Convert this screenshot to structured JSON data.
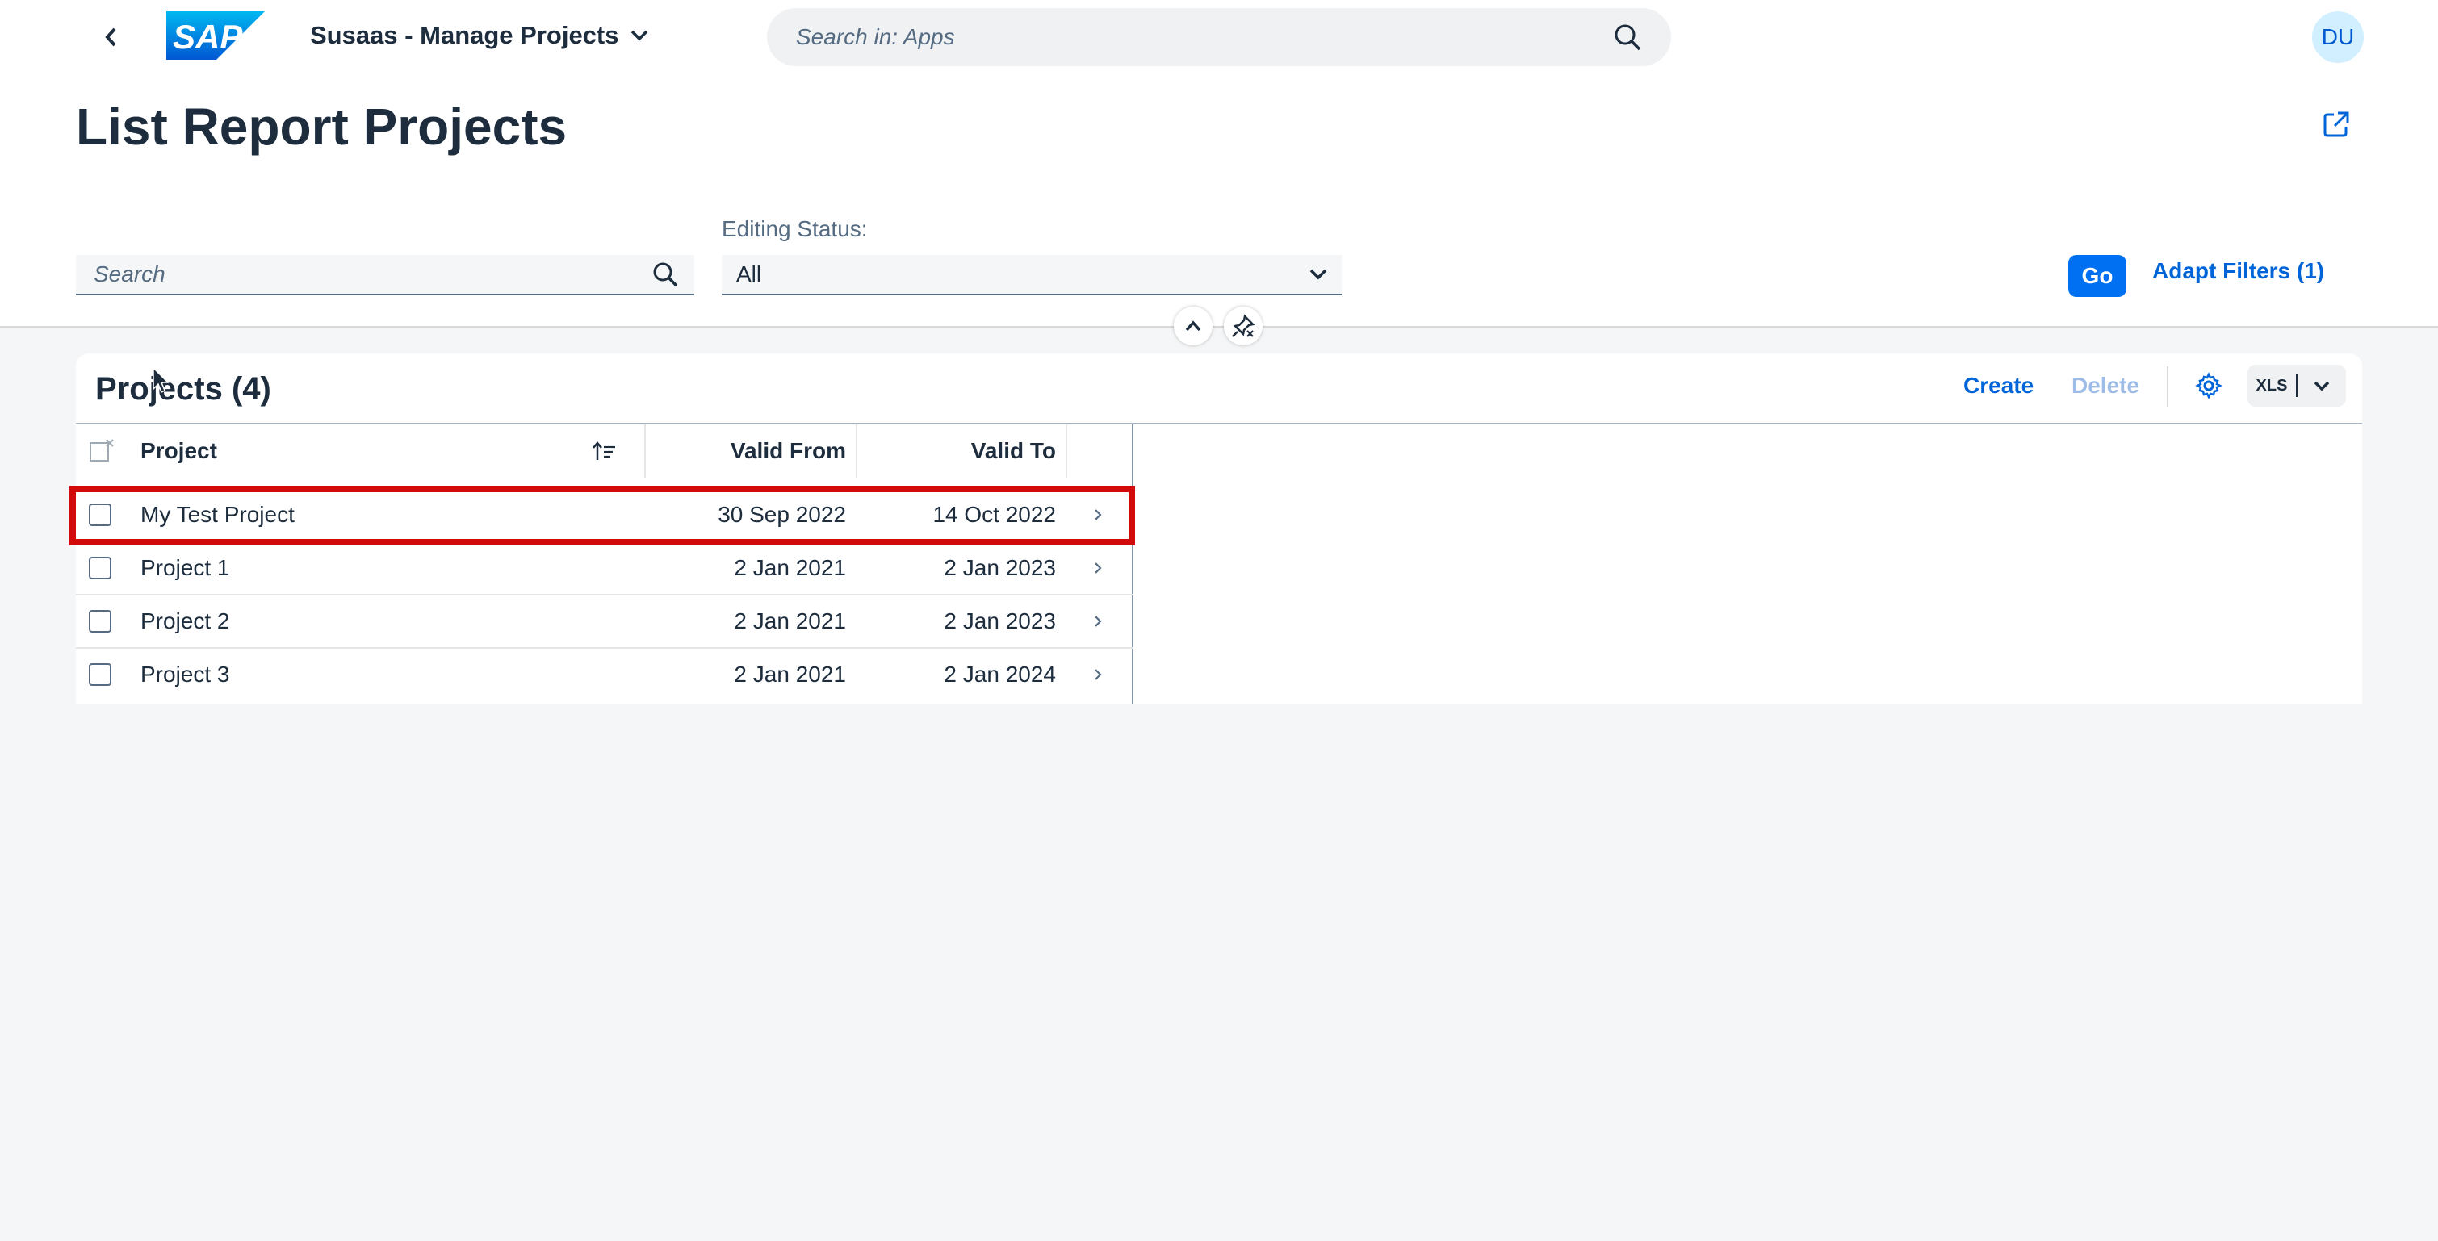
{
  "shell": {
    "logo_text": "SAP",
    "app_title": "Susaas - Manage Projects",
    "search_placeholder": "Search in: Apps",
    "user_initials": "DU"
  },
  "page": {
    "title": "List Report Projects"
  },
  "filter_bar": {
    "search_placeholder": "Search",
    "editing_status_label": "Editing Status:",
    "editing_status_value": "All",
    "go_label": "Go",
    "adapt_filters_label": "Adapt Filters (1)"
  },
  "table": {
    "title": "Projects (4)",
    "create_label": "Create",
    "delete_label": "Delete",
    "export_label": "XLS",
    "columns": [
      "Project",
      "Valid From",
      "Valid To"
    ],
    "rows": [
      {
        "project": "My Test Project",
        "valid_from": "30 Sep 2022",
        "valid_to": "14 Oct 2022"
      },
      {
        "project": "Project 1",
        "valid_from": "2 Jan 2021",
        "valid_to": "2 Jan 2023"
      },
      {
        "project": "Project 2",
        "valid_from": "2 Jan 2021",
        "valid_to": "2 Jan 2023"
      },
      {
        "project": "Project 3",
        "valid_from": "2 Jan 2021",
        "valid_to": "2 Jan 2024"
      }
    ]
  },
  "colors": {
    "brand_blue": "#0070f2",
    "link_blue": "#0064d9",
    "highlight_red": "#d20a0a"
  }
}
